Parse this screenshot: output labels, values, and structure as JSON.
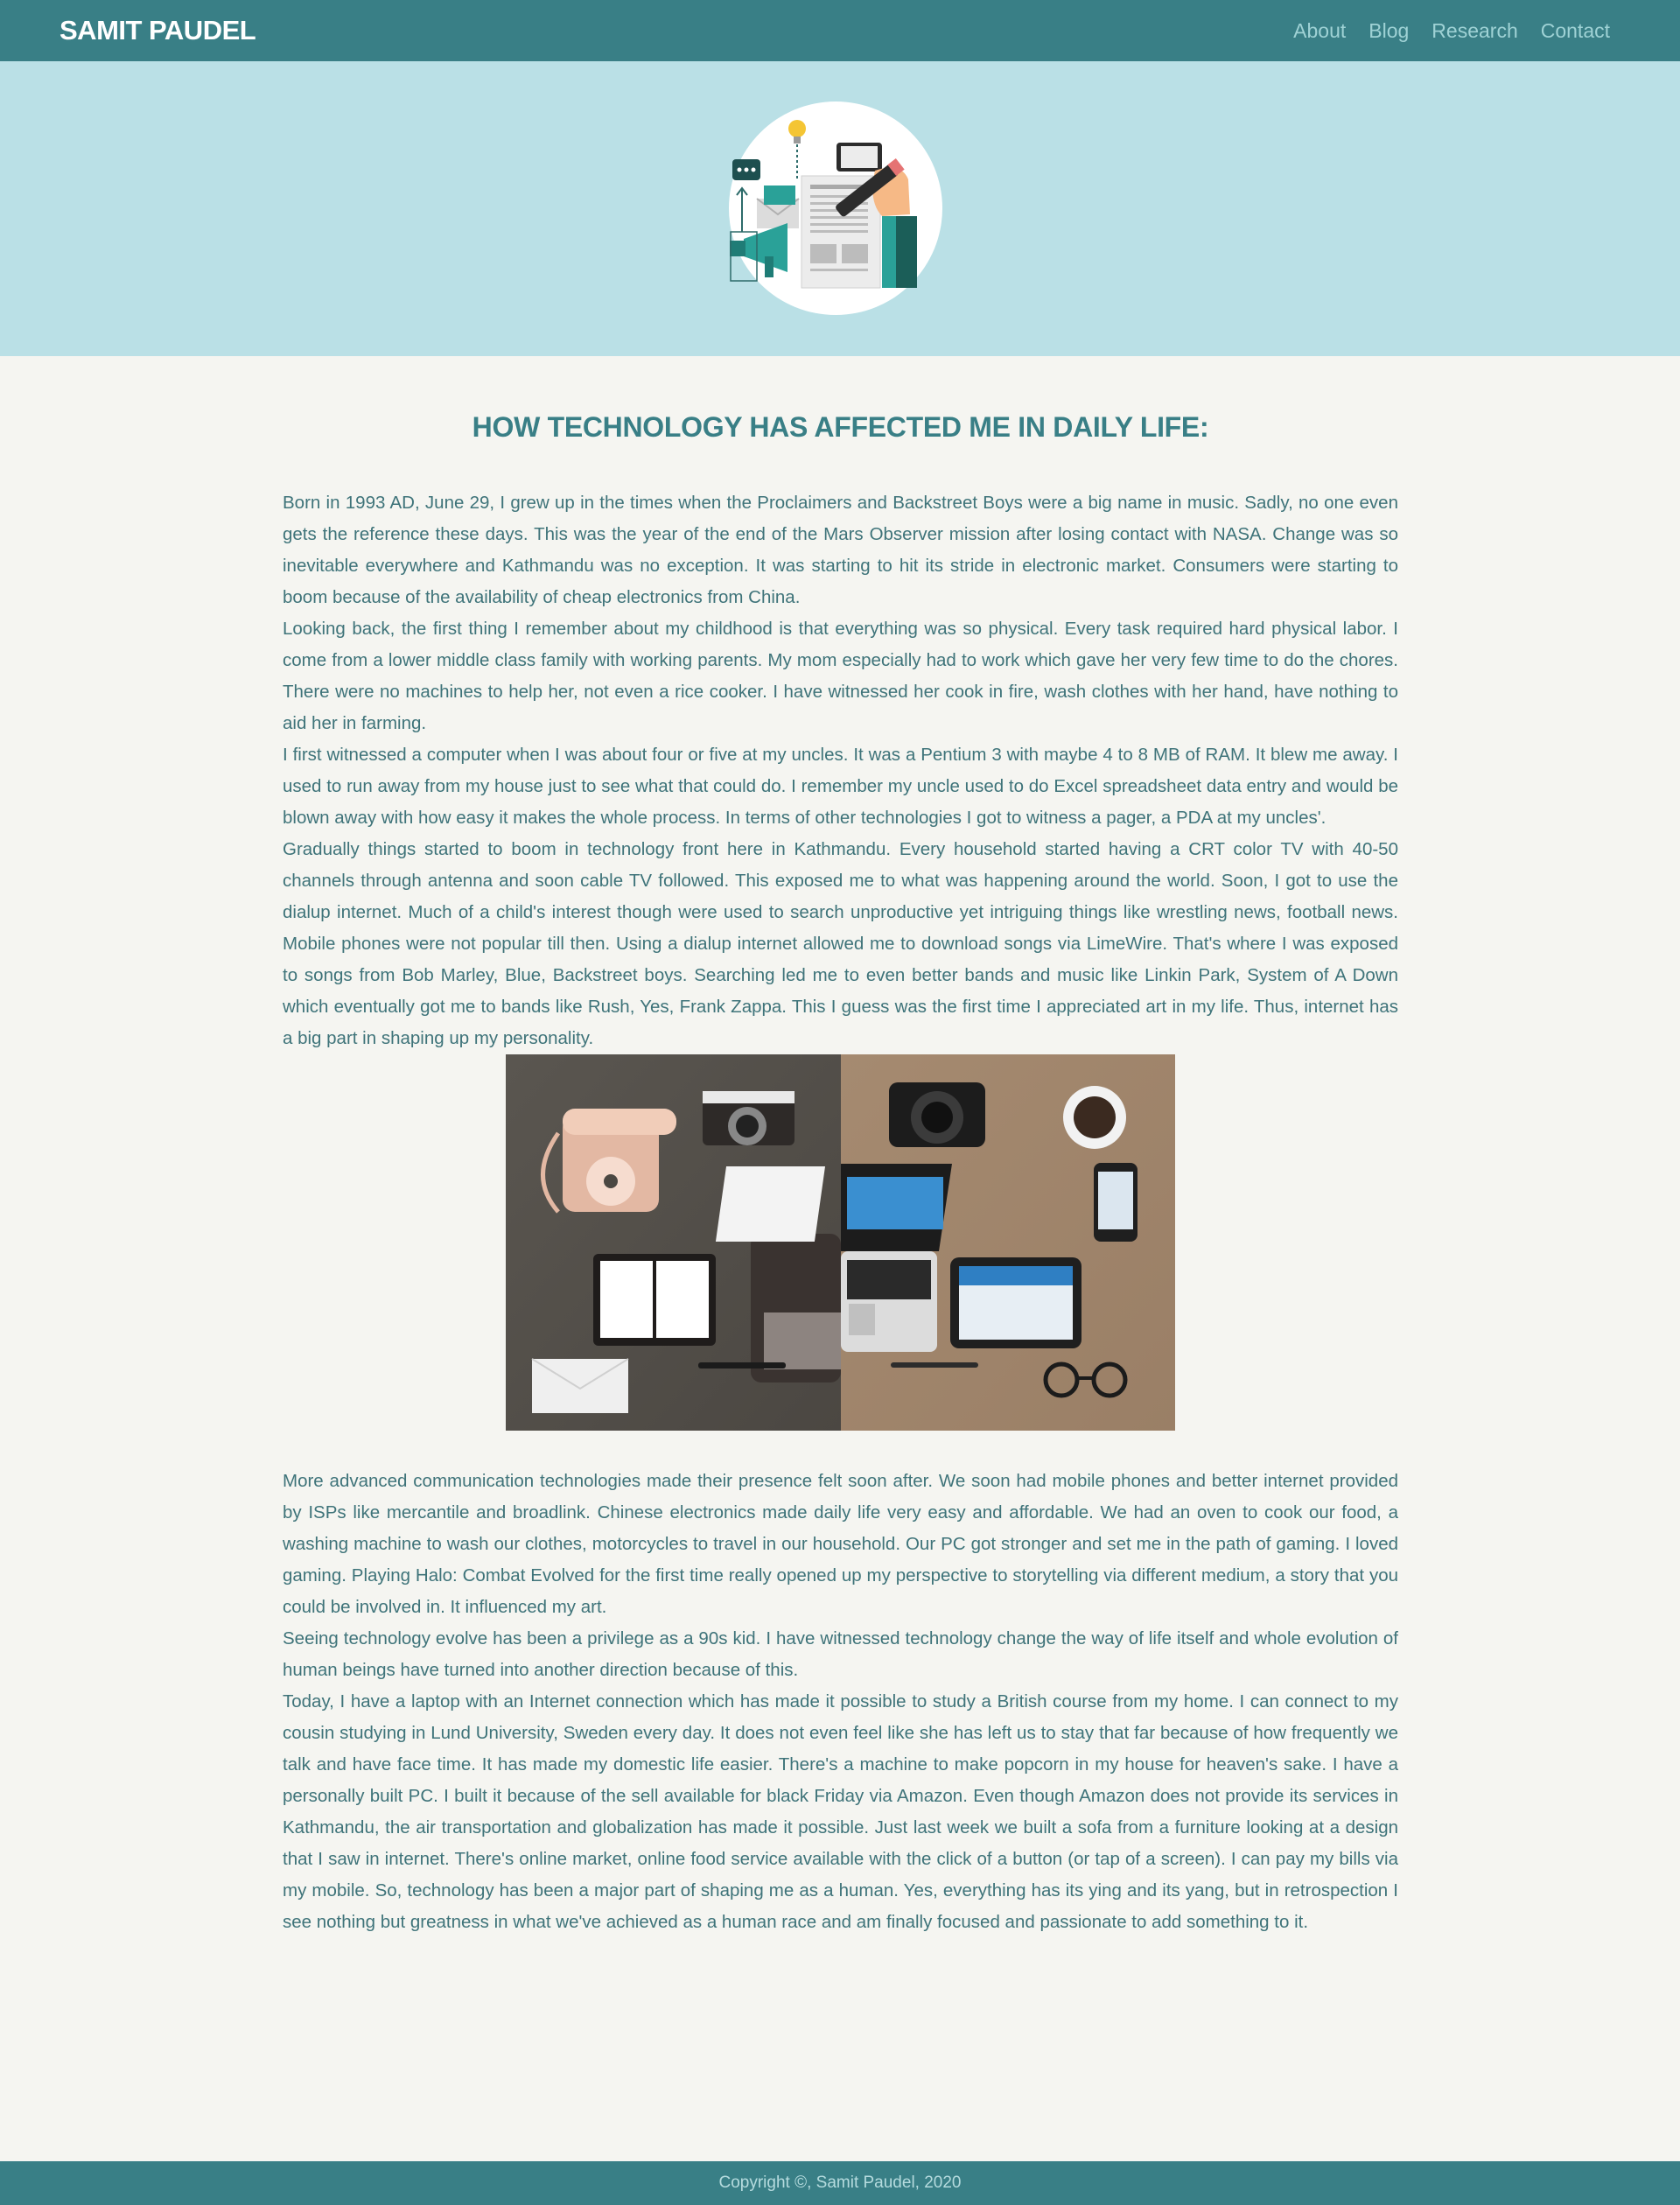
{
  "nav": {
    "brand": "SAMIT PAUDEL",
    "links": [
      "About",
      "Blog",
      "Research",
      "Contact"
    ]
  },
  "article": {
    "title": "HOW TECHNOLOGY HAS AFFECTED ME IN DAILY LIFE:",
    "paragraphs": [
      "Born in 1993 AD, June 29, I grew up in the times when the Proclaimers and Backstreet Boys were a big name in music. Sadly, no one even gets the reference these days. This was the year of the end of the Mars Observer mission after losing contact with NASA. Change was so inevitable everywhere and Kathmandu was no exception. It was starting to hit its stride in electronic market. Consumers were starting to boom because of the availability of cheap electronics from China.",
      "Looking back, the first thing I remember about my childhood is that everything was so physical. Every task required hard physical labor. I come from a lower middle class family with working parents. My mom especially had to work which gave her very few time to do the chores. There were no machines to help her, not even a rice cooker. I have witnessed her cook in fire, wash clothes with her hand, have nothing to aid her in farming.",
      "I first witnessed a computer when I was about four or five at my uncles. It was a Pentium 3 with maybe 4 to 8 MB of RAM. It blew me away. I used to run away from my house just to see what that could do. I remember my uncle used to do Excel spreadsheet data entry and would be blown away with how easy it makes the whole process. In terms of other technologies I got to witness a pager, a PDA at my uncles'.",
      "Gradually things started to boom in technology front here in Kathmandu. Every household started having a CRT color TV with 40-50 channels through antenna and soon cable TV followed. This exposed me to what was happening around the world. Soon, I got to use the dialup internet. Much of a child's interest though were used to search unproductive yet intriguing things like wrestling news, football news. Mobile phones were not popular till then. Using a dialup internet allowed me to download songs via LimeWire. That's where I was exposed to songs from Bob Marley, Blue, Backstreet boys. Searching led me to even better bands and music like Linkin Park, System of A Down which eventually got me to bands like Rush, Yes, Frank Zappa. This I guess was the first time I appreciated art in my life. Thus, internet has a big part in shaping up my personality.",
      "More advanced communication technologies made their presence felt soon after. We soon had mobile phones and better internet provided by ISPs like mercantile and broadlink. Chinese electronics made daily life very easy and affordable. We had an oven to cook our food, a washing machine to wash our clothes, motorcycles to travel in our household. Our PC got stronger and set me in the path of gaming. I loved gaming. Playing Halo: Combat Evolved for the first time really opened up my perspective to storytelling via different medium, a story that you could be involved in. It influenced my art.",
      "Seeing technology evolve has been a privilege as a 90s kid. I have witnessed technology change the way of life itself and whole evolution of human beings have turned into another direction because of this.",
      "Today, I have a laptop with an Internet connection which has made it possible to study a British course from my home. I can connect to my cousin studying in Lund University, Sweden every day. It does not even feel like she has left us to stay that far because of how frequently we talk and have face time. It has made my domestic life easier. There's a machine to make popcorn in my house for heaven's sake. I have a personally built PC. I built it because of the sell available for black Friday via Amazon. Even though Amazon does not provide its services in Kathmandu, the air transportation and globalization has made it possible. Just last week we built a sofa from a furniture looking at a design that I saw in internet. There's online market, online food service available with the click of a button (or tap of a screen). I can pay my bills via my mobile. So, technology has been a major part of shaping me as a human. Yes, everything has its ying and its yang, but in retrospection I see nothing but greatness in what we've achieved as a human race and am finally focused and passionate to add something to it."
    ]
  },
  "footer": {
    "copyright": "Copyright ©, Samit Paudel, 2020"
  },
  "colors": {
    "navbar": "#397f86",
    "hero": "#bae0e6",
    "background": "#f5f5f1",
    "text": "#3e7379"
  }
}
